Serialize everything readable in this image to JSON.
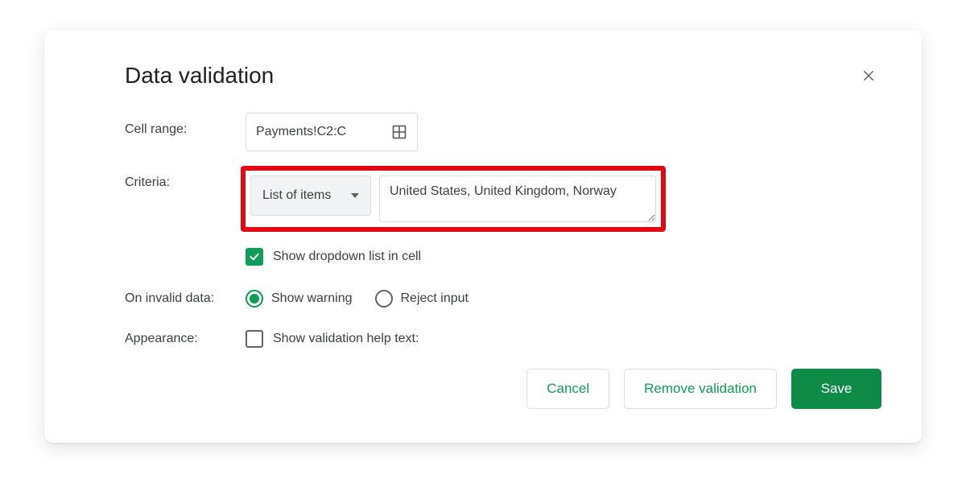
{
  "dialog": {
    "title": "Data validation",
    "close_label": "Close"
  },
  "cell_range": {
    "label": "Cell range:",
    "value": "Payments!C2:C"
  },
  "criteria": {
    "label": "Criteria:",
    "type_label": "List of items",
    "items_value": "United States, United Kingdom, Norway",
    "show_dropdown_label": "Show dropdown list in cell",
    "show_dropdown_checked": true
  },
  "invalid": {
    "label": "On invalid data:",
    "options": {
      "warning": "Show warning",
      "reject": "Reject input"
    },
    "selected": "warning"
  },
  "appearance": {
    "label": "Appearance:",
    "help_text_label": "Show validation help text:",
    "help_text_checked": false
  },
  "buttons": {
    "cancel": "Cancel",
    "remove": "Remove validation",
    "save": "Save"
  }
}
